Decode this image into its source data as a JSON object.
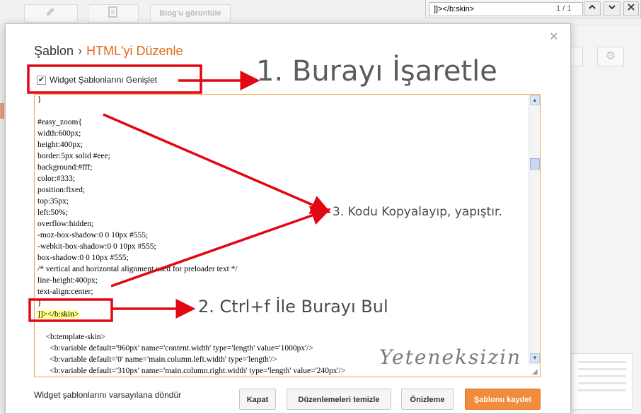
{
  "find_bar": {
    "query": "]]></b:skin>",
    "count": "1 / 1",
    "up_icon": "chevron-up-icon",
    "down_icon": "chevron-down-icon",
    "close_icon": "close-icon"
  },
  "background": {
    "view_blog_label": "Blog'u görüntüle"
  },
  "dialog": {
    "breadcrumb_parent": "Şablon",
    "breadcrumb_separator": "›",
    "breadcrumb_current": "HTML'yi Düzenle",
    "close_symbol": "×",
    "expand_widgets_label": "Widget Şablonlarını Genişlet",
    "expand_widgets_checked": true,
    "restore_widgets_label": "Widget şablonlarını varsayılana döndür",
    "buttons": {
      "close": "Kapat",
      "clear_edits": "Düzenlemeleri temizle",
      "preview": "Önizleme",
      "save": "Şablonu kaydet"
    },
    "accent_color": "#e16a1c"
  },
  "editor": {
    "lines": [
      "}",
      "",
      "#easy_zoom{",
      "width:600px;",
      "height:400px;",
      "border:5px solid #eee;",
      "background:#fff;",
      "color:#333;",
      "position:fixed;",
      "top:35px;",
      "left:50%;",
      "overflow:hidden;",
      "-moz-box-shadow:0 0 10px #555;",
      "-webkit-box-shadow:0 0 10px #555;",
      "box-shadow:0 0 10px #555;",
      "/* vertical and horizontal alignment used for preloader text */",
      "line-height:400px;",
      "text-align:center;",
      "}"
    ],
    "highlight_line": "]]></b:skin>",
    "after_lines": [
      "",
      "    <b:template-skin>",
      "      <b:variable default='960px' name='content.width' type='length' value='1000px'/>",
      "      <b:variable default='0' name='main.column.left.width' type='length'/>",
      "      <b:variable default='310px' name='main.column.right.width' type='length' value='240px'/>"
    ]
  },
  "annotations": {
    "step1": "1. Burayı İşaretle",
    "step2": "2. Ctrl+f İle Burayı Bul",
    "step3": "3. Kodu Kopyalayıp, yapıştır.",
    "watermark": "Yeteneksizin",
    "arrow_color": "#e30613"
  }
}
